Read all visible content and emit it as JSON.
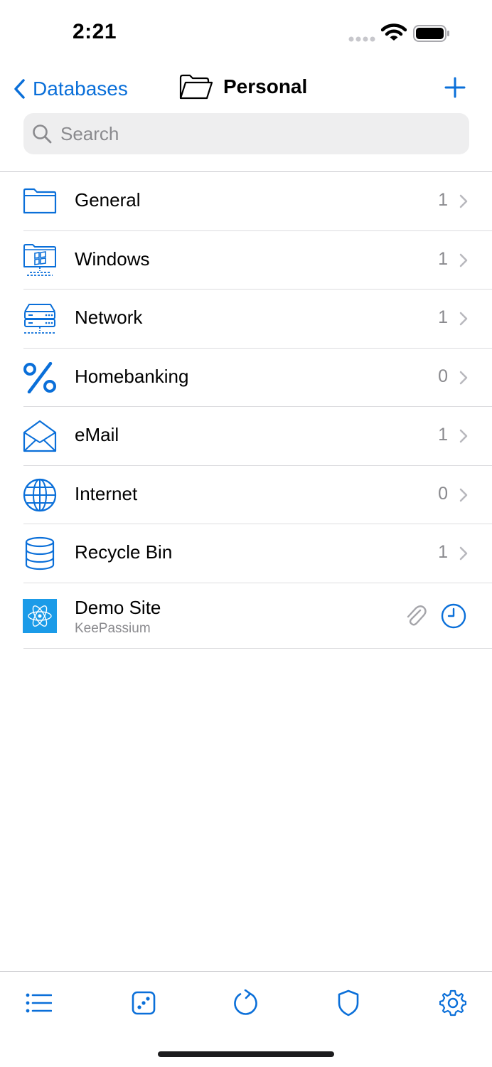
{
  "status": {
    "time": "2:21"
  },
  "nav": {
    "back_label": "Databases",
    "title": "Personal"
  },
  "search": {
    "placeholder": "Search",
    "value": ""
  },
  "groups": [
    {
      "name": "General",
      "count": "1",
      "icon": "folder-icon"
    },
    {
      "name": "Windows",
      "count": "1",
      "icon": "windows-computer-icon"
    },
    {
      "name": "Network",
      "count": "1",
      "icon": "network-server-icon"
    },
    {
      "name": "Homebanking",
      "count": "0",
      "icon": "percent-icon"
    },
    {
      "name": "eMail",
      "count": "1",
      "icon": "envelope-open-icon"
    },
    {
      "name": "Internet",
      "count": "0",
      "icon": "globe-icon"
    },
    {
      "name": "Recycle Bin",
      "count": "1",
      "icon": "database-icon"
    }
  ],
  "entries": [
    {
      "title": "Demo Site",
      "subtitle": "KeePassium",
      "icon": "atom-icon",
      "has_attachment": true,
      "has_expiry": true
    }
  ],
  "tabbar": [
    "list-icon",
    "dice-icon",
    "refresh-icon",
    "shield-icon",
    "gear-icon"
  ],
  "colors": {
    "accent": "#0a6fd9",
    "secondary_text": "#8a8a8e",
    "entry_icon_bg": "#1b9be8"
  }
}
